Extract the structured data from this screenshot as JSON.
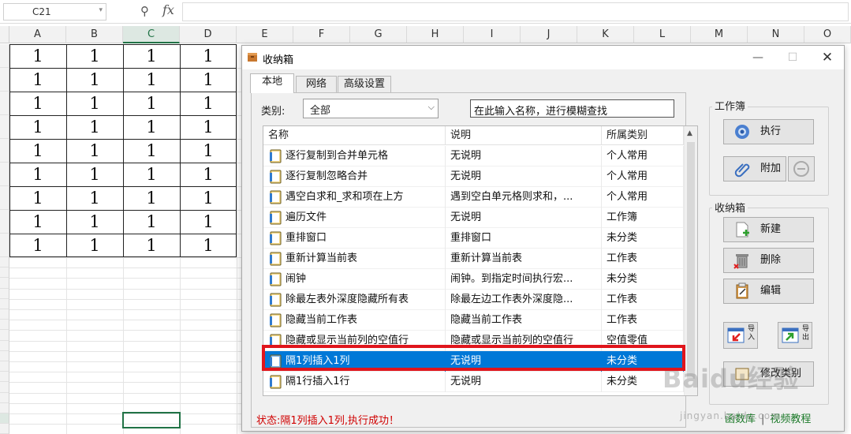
{
  "formula_bar": {
    "name_box": "C21",
    "zoom_icon": "zoom-icon",
    "fx": "fx"
  },
  "sheet": {
    "columns": [
      "A",
      "B",
      "C",
      "D",
      "E",
      "F",
      "G",
      "H",
      "I",
      "J",
      "K",
      "L",
      "M",
      "N",
      "O"
    ],
    "selected_column": "C",
    "cell_value": "1",
    "rows": 9,
    "cols": 4
  },
  "dialog": {
    "title": "收纳箱",
    "tabs": [
      "本地",
      "网络",
      "高级设置"
    ],
    "active_tab": "本地",
    "category_label": "类别:",
    "category_value": "全部",
    "search_value": "在此输入名称，进行模糊查找",
    "list_headers": [
      "名称",
      "说明",
      "所属类别"
    ],
    "items": [
      {
        "name": "逐行复制到合并单元格",
        "desc": "无说明",
        "cat": "个人常用"
      },
      {
        "name": "逐行复制忽略合并",
        "desc": "无说明",
        "cat": "个人常用"
      },
      {
        "name": "遇空白求和_求和项在上方",
        "desc": "遇到空白单元格则求和，...",
        "cat": "个人常用"
      },
      {
        "name": "遍历文件",
        "desc": "无说明",
        "cat": "工作簿"
      },
      {
        "name": "重排窗口",
        "desc": "重排窗口",
        "cat": "未分类"
      },
      {
        "name": "重新计算当前表",
        "desc": "重新计算当前表",
        "cat": "工作表"
      },
      {
        "name": "闹钟",
        "desc": "闹钟。到指定时间执行宏...",
        "cat": "未分类"
      },
      {
        "name": "除最左表外深度隐藏所有表",
        "desc": "除最左边工作表外深度隐...",
        "cat": "工作表"
      },
      {
        "name": "隐藏当前工作表",
        "desc": "隐藏当前工作表",
        "cat": "工作表"
      },
      {
        "name": "隐藏或显示当前列的空值行",
        "desc": "隐藏或显示当前列的空值行",
        "cat": "空值零值"
      },
      {
        "name": "隔1列插入1列",
        "desc": "无说明",
        "cat": "未分类"
      },
      {
        "name": "隔1行插入1行",
        "desc": "无说明",
        "cat": "未分类"
      }
    ],
    "selected_index": 10,
    "status": "状态:隔1列插入1列,执行成功！",
    "workbook_group": {
      "title": "工作簿",
      "execute": "执行",
      "attach": "附加"
    },
    "box_group": {
      "title": "收纳箱",
      "new": "新建",
      "delete": "删除",
      "edit": "编辑",
      "import": "导入",
      "export": "导出",
      "modify": "修改类别"
    },
    "links": {
      "functions": "函数库",
      "sep": "|",
      "videos": "视频教程"
    }
  },
  "watermark": {
    "main": "Baidu经验",
    "sub": "jingyan.baidu.com"
  },
  "colors": {
    "selection": "#0078d7",
    "highlight_border": "#e0151c",
    "status_red": "#d00000",
    "excel_green": "#217346"
  }
}
